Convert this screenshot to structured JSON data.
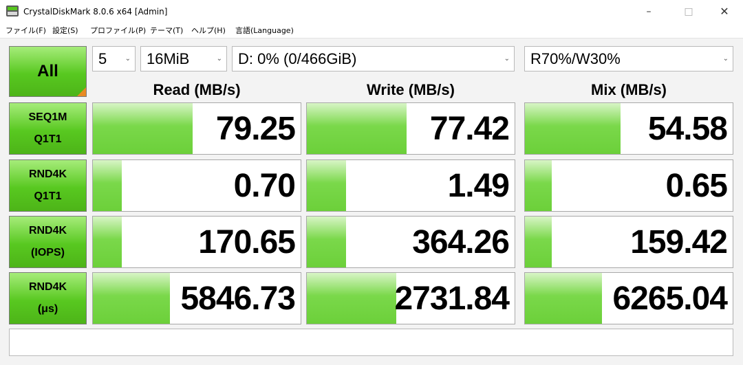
{
  "window": {
    "title": "CrystalDiskMark 8.0.6 x64 [Admin]"
  },
  "menu": [
    "ファイル(F)",
    "設定(S)",
    "プロファイル(P)",
    "テーマ(T)",
    "ヘルプ(H)",
    "言語(Language)"
  ],
  "controls": {
    "all_label": "All",
    "count": "5",
    "size": "16MiB",
    "drive": "D: 0% (0/466GiB)",
    "mix": "R70%/W30%"
  },
  "headers": {
    "read": "Read (MB/s)",
    "write": "Write (MB/s)",
    "mix": "Mix (MB/s)"
  },
  "rows": [
    {
      "line1": "SEQ1M",
      "line2": "Q1T1",
      "read": {
        "value": "79.25",
        "fill": 0.48
      },
      "write": {
        "value": "77.42",
        "fill": 0.48
      },
      "mix": {
        "value": "54.58",
        "fill": 0.46
      }
    },
    {
      "line1": "RND4K",
      "line2": "Q1T1",
      "read": {
        "value": "0.70",
        "fill": 0.14
      },
      "write": {
        "value": "1.49",
        "fill": 0.19
      },
      "mix": {
        "value": "0.65",
        "fill": 0.13
      }
    },
    {
      "line1": "RND4K",
      "line2": "(IOPS)",
      "read": {
        "value": "170.65",
        "fill": 0.14
      },
      "write": {
        "value": "364.26",
        "fill": 0.19
      },
      "mix": {
        "value": "159.42",
        "fill": 0.13
      }
    },
    {
      "line1": "RND4K",
      "line2": "(μs)",
      "read": {
        "value": "5846.73",
        "fill": 0.37
      },
      "write": {
        "value": "2731.84",
        "fill": 0.43
      },
      "mix": {
        "value": "6265.04",
        "fill": 0.37
      }
    }
  ],
  "comment": "",
  "colors": {
    "accent_green": "#58c820",
    "bar_green": "#7ad84a",
    "corner_orange": "#e88a24"
  },
  "icons": [
    "app-icon",
    "minimize-icon",
    "maximize-icon",
    "close-icon",
    "chevron-down-icon"
  ]
}
